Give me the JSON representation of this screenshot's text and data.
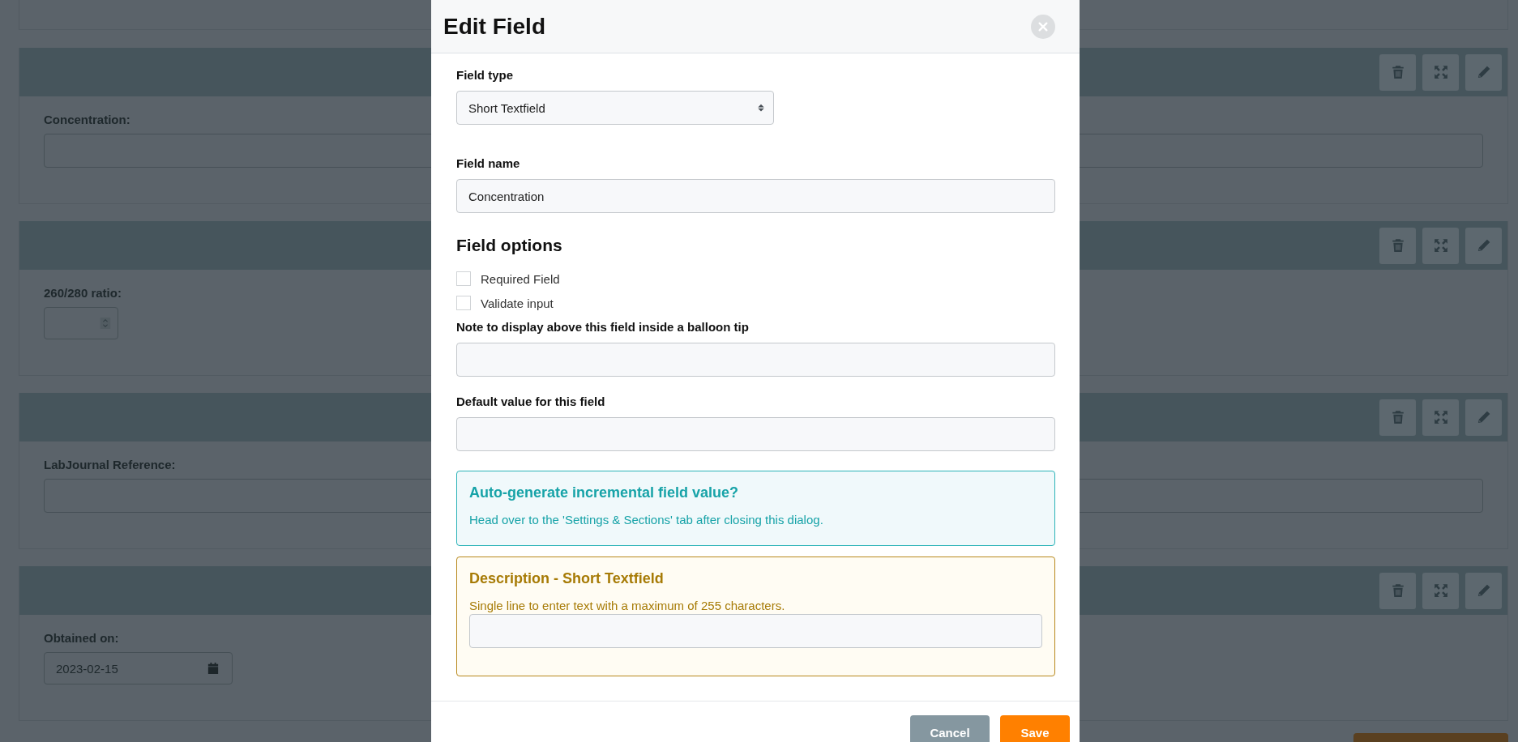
{
  "background_fields": [
    {
      "kind": "text",
      "label": "Concentration:"
    },
    {
      "kind": "number",
      "label": "260/280 ratio:"
    },
    {
      "kind": "text",
      "label": "LabJournal Reference:"
    },
    {
      "kind": "date",
      "label": "Obtained on:",
      "value": "2023-02-15"
    }
  ],
  "dialog": {
    "title": "Edit Field",
    "field_type": {
      "label": "Field type",
      "value": "Short Textfield"
    },
    "field_name": {
      "label": "Field name",
      "value": "Concentration"
    },
    "options_heading": "Field options",
    "options": [
      {
        "label": "Required Field",
        "checked": false
      },
      {
        "label": "Validate input",
        "checked": false
      }
    ],
    "note": {
      "label": "Note to display above this field inside a balloon tip"
    },
    "default_value": {
      "label": "Default value for this field"
    },
    "info": {
      "title": "Auto-generate incremental field value?",
      "text": "Head over to the 'Settings & Sections' tab after closing this dialog."
    },
    "description": {
      "title": "Description - Short Textfield",
      "text": "Single line to enter text with a maximum of 255 characters."
    },
    "buttons": [
      {
        "kind": "secondary",
        "label": "Cancel"
      },
      {
        "kind": "primary",
        "label": "Save"
      }
    ]
  }
}
